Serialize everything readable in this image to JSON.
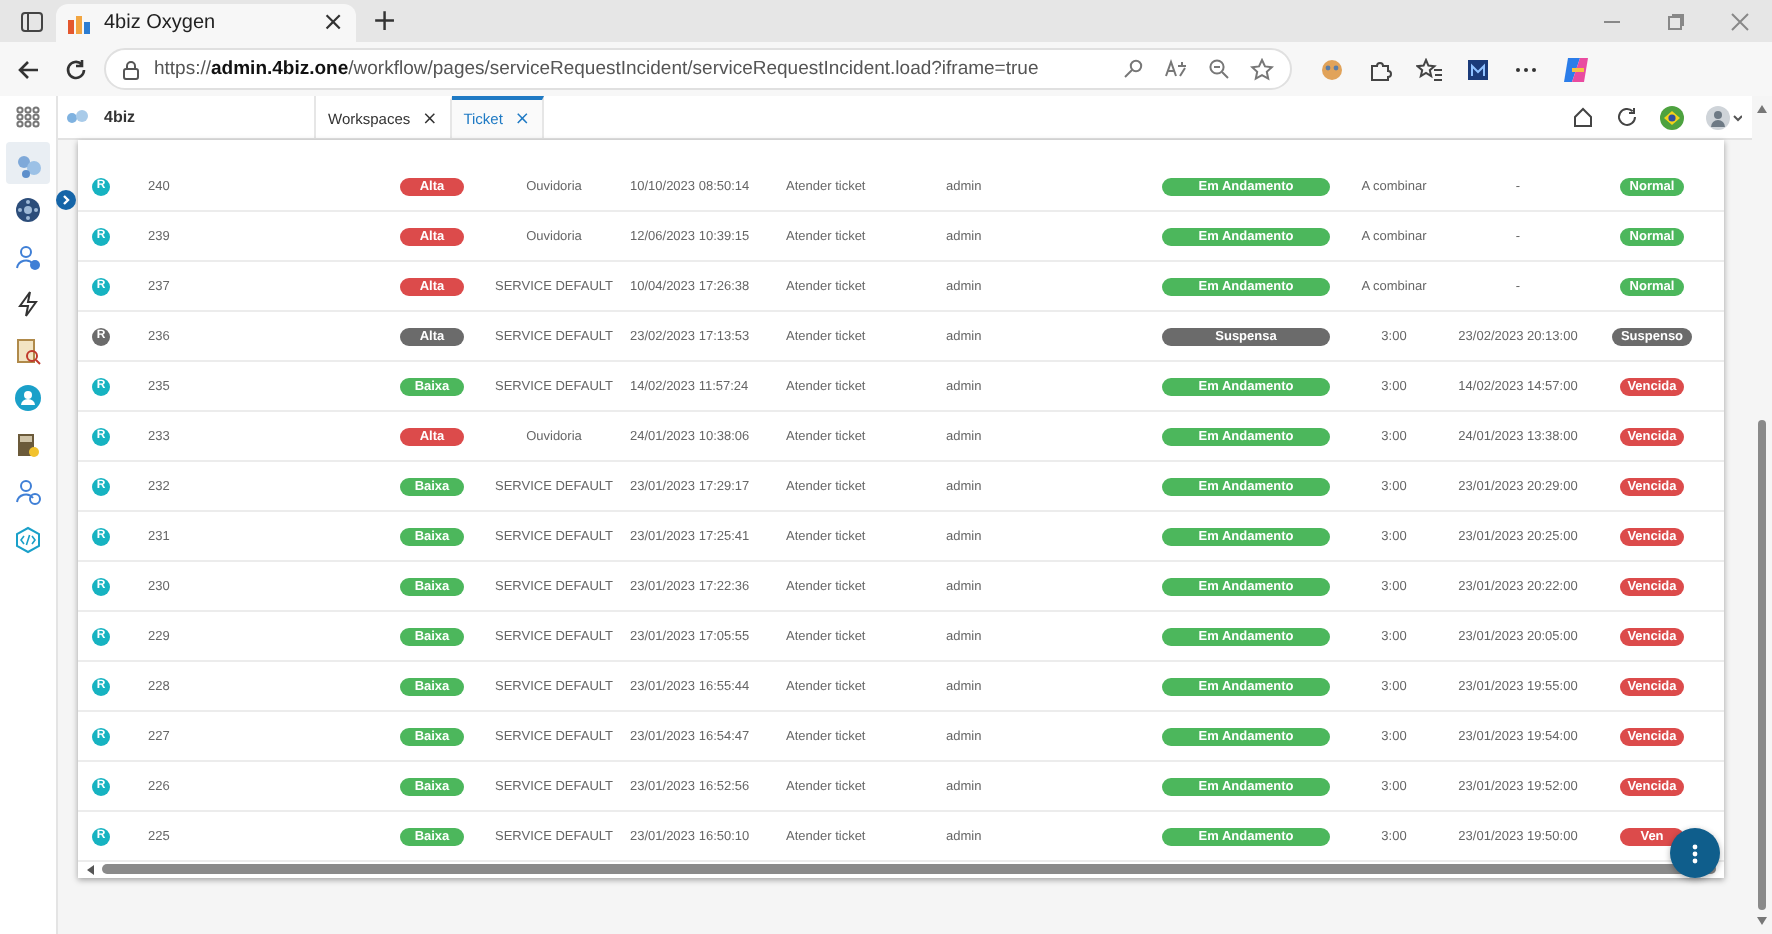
{
  "browser": {
    "tab_title": "4biz Oxygen",
    "tab_close": "×",
    "new_tab": "+",
    "url": "https://**admin.4biz.one**/workflow/pages/serviceRequestIncident/serviceRequestIncident.load?iframe=true"
  },
  "app": {
    "brand": "4biz",
    "tabs": [
      {
        "label": "Workspaces",
        "close": "×",
        "selected": false
      },
      {
        "label": "Ticket",
        "close": "×",
        "selected": true
      }
    ]
  },
  "sidebar": {
    "items": [
      {
        "selected": true
      },
      {
        "selected": false
      },
      {
        "selected": false
      },
      {
        "selected": false
      },
      {
        "selected": false
      },
      {
        "selected": false
      },
      {
        "selected": false
      },
      {
        "selected": false
      },
      {
        "selected": false
      }
    ]
  },
  "table": {
    "rows": [
      {
        "type": {
          "text": "R",
          "color": "#17b3c1"
        },
        "number": "240",
        "priority": {
          "text": "Alta",
          "color": "#dc4b4b"
        },
        "group": "Ouvidoria",
        "opened": "10/10/2023 08:50:14",
        "task": "Atender ticket",
        "user": "admin",
        "status": {
          "text": "Em Andamento",
          "color": "#4cb75c"
        },
        "time": "A combinar",
        "deadline": "-",
        "sla": {
          "text": "Normal",
          "color": "#4cb75c"
        }
      },
      {
        "type": {
          "text": "R",
          "color": "#17b3c1"
        },
        "number": "239",
        "priority": {
          "text": "Alta",
          "color": "#dc4b4b"
        },
        "group": "Ouvidoria",
        "opened": "12/06/2023 10:39:15",
        "task": "Atender ticket",
        "user": "admin",
        "status": {
          "text": "Em Andamento",
          "color": "#4cb75c"
        },
        "time": "A combinar",
        "deadline": "-",
        "sla": {
          "text": "Normal",
          "color": "#4cb75c"
        }
      },
      {
        "type": {
          "text": "R",
          "color": "#17b3c1"
        },
        "number": "237",
        "priority": {
          "text": "Alta",
          "color": "#dc4b4b"
        },
        "group": "SERVICE DEFAULT",
        "opened": "10/04/2023 17:26:38",
        "task": "Atender ticket",
        "user": "admin",
        "status": {
          "text": "Em Andamento",
          "color": "#4cb75c"
        },
        "time": "A combinar",
        "deadline": "-",
        "sla": {
          "text": "Normal",
          "color": "#4cb75c"
        }
      },
      {
        "type": {
          "text": "R",
          "color": "#6b6b6b"
        },
        "number": "236",
        "priority": {
          "text": "Alta",
          "color": "#6b6b6b"
        },
        "group": "SERVICE DEFAULT",
        "opened": "23/02/2023 17:13:53",
        "task": "Atender ticket",
        "user": "admin",
        "status": {
          "text": "Suspensa",
          "color": "#6b6b6b"
        },
        "time": "3:00",
        "deadline": "23/02/2023 20:13:00",
        "sla": {
          "text": "Suspenso",
          "color": "#6b6b6b"
        }
      },
      {
        "type": {
          "text": "R",
          "color": "#17b3c1"
        },
        "number": "235",
        "priority": {
          "text": "Baixa",
          "color": "#4cb75c"
        },
        "group": "SERVICE DEFAULT",
        "opened": "14/02/2023 11:57:24",
        "task": "Atender ticket",
        "user": "admin",
        "status": {
          "text": "Em Andamento",
          "color": "#4cb75c"
        },
        "time": "3:00",
        "deadline": "14/02/2023 14:57:00",
        "sla": {
          "text": "Vencida",
          "color": "#dc4b4b"
        }
      },
      {
        "type": {
          "text": "R",
          "color": "#17b3c1"
        },
        "number": "233",
        "priority": {
          "text": "Alta",
          "color": "#dc4b4b"
        },
        "group": "Ouvidoria",
        "opened": "24/01/2023 10:38:06",
        "task": "Atender ticket",
        "user": "admin",
        "status": {
          "text": "Em Andamento",
          "color": "#4cb75c"
        },
        "time": "3:00",
        "deadline": "24/01/2023 13:38:00",
        "sla": {
          "text": "Vencida",
          "color": "#dc4b4b"
        }
      },
      {
        "type": {
          "text": "R",
          "color": "#17b3c1"
        },
        "number": "232",
        "priority": {
          "text": "Baixa",
          "color": "#4cb75c"
        },
        "group": "SERVICE DEFAULT",
        "opened": "23/01/2023 17:29:17",
        "task": "Atender ticket",
        "user": "admin",
        "status": {
          "text": "Em Andamento",
          "color": "#4cb75c"
        },
        "time": "3:00",
        "deadline": "23/01/2023 20:29:00",
        "sla": {
          "text": "Vencida",
          "color": "#dc4b4b"
        }
      },
      {
        "type": {
          "text": "R",
          "color": "#17b3c1"
        },
        "number": "231",
        "priority": {
          "text": "Baixa",
          "color": "#4cb75c"
        },
        "group": "SERVICE DEFAULT",
        "opened": "23/01/2023 17:25:41",
        "task": "Atender ticket",
        "user": "admin",
        "status": {
          "text": "Em Andamento",
          "color": "#4cb75c"
        },
        "time": "3:00",
        "deadline": "23/01/2023 20:25:00",
        "sla": {
          "text": "Vencida",
          "color": "#dc4b4b"
        }
      },
      {
        "type": {
          "text": "R",
          "color": "#17b3c1"
        },
        "number": "230",
        "priority": {
          "text": "Baixa",
          "color": "#4cb75c"
        },
        "group": "SERVICE DEFAULT",
        "opened": "23/01/2023 17:22:36",
        "task": "Atender ticket",
        "user": "admin",
        "status": {
          "text": "Em Andamento",
          "color": "#4cb75c"
        },
        "time": "3:00",
        "deadline": "23/01/2023 20:22:00",
        "sla": {
          "text": "Vencida",
          "color": "#dc4b4b"
        }
      },
      {
        "type": {
          "text": "R",
          "color": "#17b3c1"
        },
        "number": "229",
        "priority": {
          "text": "Baixa",
          "color": "#4cb75c"
        },
        "group": "SERVICE DEFAULT",
        "opened": "23/01/2023 17:05:55",
        "task": "Atender ticket",
        "user": "admin",
        "status": {
          "text": "Em Andamento",
          "color": "#4cb75c"
        },
        "time": "3:00",
        "deadline": "23/01/2023 20:05:00",
        "sla": {
          "text": "Vencida",
          "color": "#dc4b4b"
        }
      },
      {
        "type": {
          "text": "R",
          "color": "#17b3c1"
        },
        "number": "228",
        "priority": {
          "text": "Baixa",
          "color": "#4cb75c"
        },
        "group": "SERVICE DEFAULT",
        "opened": "23/01/2023 16:55:44",
        "task": "Atender ticket",
        "user": "admin",
        "status": {
          "text": "Em Andamento",
          "color": "#4cb75c"
        },
        "time": "3:00",
        "deadline": "23/01/2023 19:55:00",
        "sla": {
          "text": "Vencida",
          "color": "#dc4b4b"
        }
      },
      {
        "type": {
          "text": "R",
          "color": "#17b3c1"
        },
        "number": "227",
        "priority": {
          "text": "Baixa",
          "color": "#4cb75c"
        },
        "group": "SERVICE DEFAULT",
        "opened": "23/01/2023 16:54:47",
        "task": "Atender ticket",
        "user": "admin",
        "status": {
          "text": "Em Andamento",
          "color": "#4cb75c"
        },
        "time": "3:00",
        "deadline": "23/01/2023 19:54:00",
        "sla": {
          "text": "Vencida",
          "color": "#dc4b4b"
        }
      },
      {
        "type": {
          "text": "R",
          "color": "#17b3c1"
        },
        "number": "226",
        "priority": {
          "text": "Baixa",
          "color": "#4cb75c"
        },
        "group": "SERVICE DEFAULT",
        "opened": "23/01/2023 16:52:56",
        "task": "Atender ticket",
        "user": "admin",
        "status": {
          "text": "Em Andamento",
          "color": "#4cb75c"
        },
        "time": "3:00",
        "deadline": "23/01/2023 19:52:00",
        "sla": {
          "text": "Vencida",
          "color": "#dc4b4b"
        }
      },
      {
        "type": {
          "text": "R",
          "color": "#17b3c1"
        },
        "number": "225",
        "priority": {
          "text": "Baixa",
          "color": "#4cb75c"
        },
        "group": "SERVICE DEFAULT",
        "opened": "23/01/2023 16:50:10",
        "task": "Atender ticket",
        "user": "admin",
        "status": {
          "text": "Em Andamento",
          "color": "#4cb75c"
        },
        "time": "3:00",
        "deadline": "23/01/2023 19:50:00",
        "sla": {
          "text": "Ven",
          "color": "#dc4b4b"
        }
      }
    ]
  }
}
